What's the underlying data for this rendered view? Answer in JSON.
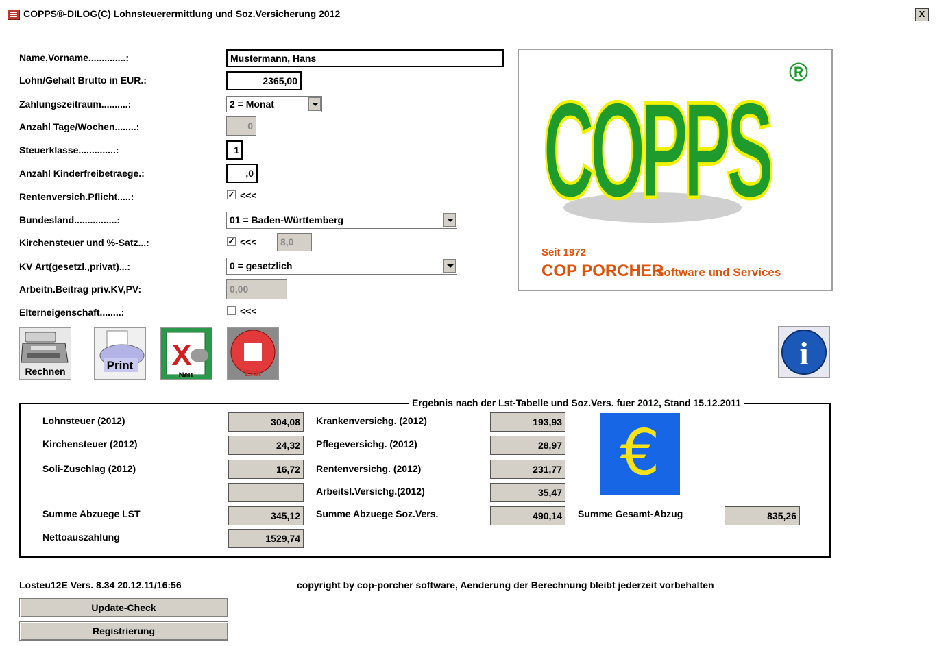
{
  "window": {
    "title": "COPPS®-DILOG(C) Lohnsteuerermittlung und Soz.Versicherung 2012",
    "close_label": "X"
  },
  "form": {
    "name_label": "Name,Vorname..............:",
    "name_value": "Mustermann, Hans",
    "brutto_label": "Lohn/Gehalt Brutto in EUR.:",
    "brutto_value": "2365,00",
    "zeitraum_label": "Zahlungszeitraum..........:",
    "zeitraum_value": "2 = Monat",
    "tage_label": "Anzahl Tage/Wochen........:",
    "tage_value": "0",
    "steuerklasse_label": "Steuerklasse..............:",
    "steuerklasse_value": "1",
    "kinder_label": "Anzahl Kinderfreibetraege.:",
    "kinder_value": ",0",
    "renten_label": "Rentenversich.Pflicht.....:",
    "renten_checked": "✓",
    "renten_hint": "<<<",
    "bundesland_label": "Bundesland................:",
    "bundesland_value": "01 = Baden-Württemberg",
    "kirchen_label": "Kirchensteuer und %-Satz...:",
    "kirchen_checked": "✓",
    "kirchen_hint": "<<<",
    "kirchen_satz": "8,0",
    "kv_label": "KV Art(gesetzl.,privat)...:",
    "kv_value": "0 = gesetzlich",
    "arbeitn_label": "Arbeitn.Beitrag priv.KV,PV:",
    "arbeitn_value": "0,00",
    "eltern_label": "Elterneigenschaft........:",
    "eltern_checked": "",
    "eltern_hint": "<<<"
  },
  "logo": {
    "brand": "COPPS",
    "registered": "®",
    "since": "Seit 1972",
    "company_bold": "COP PORCHER",
    "company_rest": "Software und Services"
  },
  "toolbar": {
    "rechnen_label": "Rechnen",
    "print_label": "Print",
    "neu_label": "Neu",
    "exit_label": "Exit",
    "info_label": "i"
  },
  "result": {
    "legend": "Ergebnis nach der Lst-Tabelle und Soz.Vers. fuer 2012, Stand 15.12.2011",
    "lohnsteuer_label": "Lohnsteuer (2012)",
    "lohnsteuer_value": "304,08",
    "kirchensteuer_label": "Kirchensteuer (2012)",
    "kirchensteuer_value": "24,32",
    "soli_label": "Soli-Zuschlag (2012)",
    "soli_value": "16,72",
    "empty_value": "",
    "summe_lst_label": "Summe Abzuege LST",
    "summe_lst_value": "345,12",
    "netto_label": "Nettoauszahlung",
    "netto_value": "1529,74",
    "kranken_label": "Krankenversichg. (2012)",
    "kranken_value": "193,93",
    "pflege_label": "Pflegeversichg. (2012)",
    "pflege_value": "28,97",
    "rentenv_label": "Rentenversichg. (2012)",
    "rentenv_value": "231,77",
    "arbeitsl_label": "Arbeitsl.Versichg.(2012)",
    "arbeitsl_value": "35,47",
    "summe_sv_label": "Summe Abzuege Soz.Vers.",
    "summe_sv_value": "490,14",
    "gesamt_label": "Summe Gesamt-Abzug",
    "gesamt_value": "835,26",
    "euro_symbol": "€"
  },
  "footer": {
    "version": "Losteu12E Vers. 8.34  20.12.11/16:56",
    "copyright": "copyright by cop-porcher software, Aenderung der Berechnung bleibt jederzeit vorbehalten",
    "update_label": "Update-Check",
    "register_label": "Registrierung"
  },
  "colors": {
    "logo_green": "#1f9a2c",
    "logo_yellow": "#f2f200",
    "euro_blue": "#1766e6",
    "euro_yellow": "#f5e21b",
    "logo_red": "#e0520a"
  }
}
